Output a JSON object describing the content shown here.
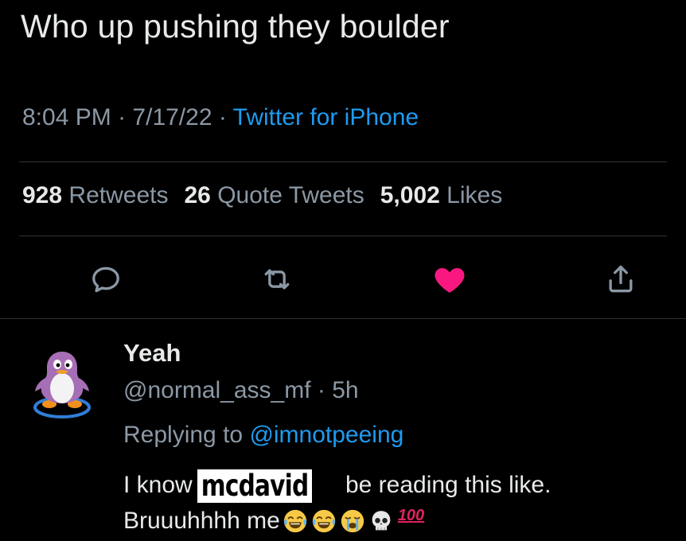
{
  "tweet": {
    "text": "Who up pushing they boulder",
    "time": "8:04 PM",
    "separator": "·",
    "date": "7/17/22",
    "source": "Twitter for iPhone"
  },
  "stats": {
    "retweets_count": "928",
    "retweets_label": "Retweets",
    "quotes_count": "26",
    "quotes_label": "Quote Tweets",
    "likes_count": "5,002",
    "likes_label": "Likes"
  },
  "actions": {
    "reply": "reply-icon",
    "retweet": "retweet-icon",
    "like": "heart-icon",
    "share": "share-icon",
    "like_color": "#f91880",
    "icon_color": "#8b98a5"
  },
  "reply": {
    "name": "Yeah",
    "handle": "@normal_ass_mf",
    "separator": "·",
    "age": "5h",
    "replying_prefix": "Replying to",
    "replying_to": "@imnotpeeing",
    "text_part1": "I know",
    "overlay_name": "mcdavid",
    "text_part2": "be reading this like.",
    "text_line2": "Bruuuhhhh me",
    "emojis": [
      "laughing-tears-emoji",
      "laughing-tears-emoji",
      "crying-emoji",
      "skull-emoji",
      "hundred-emoji"
    ],
    "hundred_text": "100"
  },
  "colors": {
    "background": "#000000",
    "text": "#e7e9ea",
    "muted": "#8b98a5",
    "link": "#1d9bf0",
    "divider": "#2f3336"
  }
}
